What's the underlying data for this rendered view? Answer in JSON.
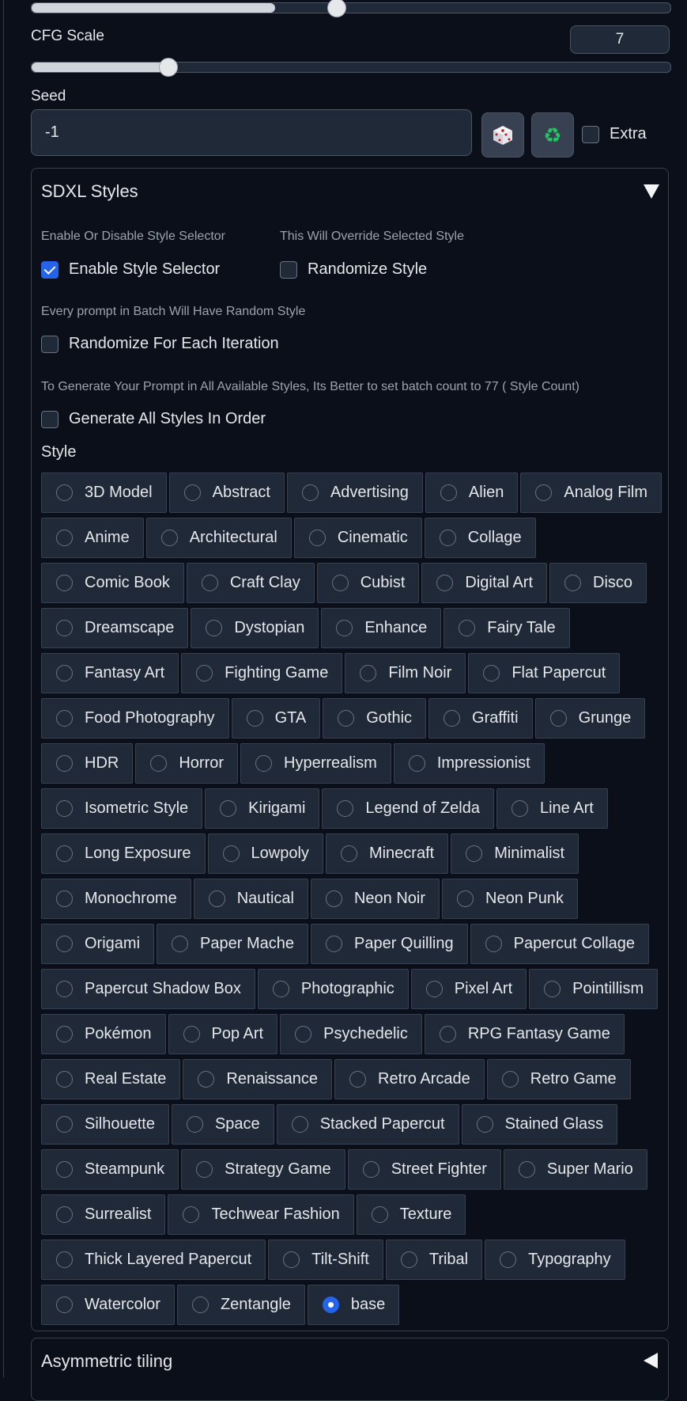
{
  "cfg": {
    "label": "CFG Scale",
    "value": "7"
  },
  "seed": {
    "label": "Seed",
    "value": "-1",
    "extra_label": "Extra"
  },
  "sdxl": {
    "title": "SDXL Styles",
    "enable_info": "Enable Or Disable Style Selector",
    "enable_label": "Enable Style Selector",
    "override_info": "This Will Override Selected Style",
    "randomize_label": "Randomize Style",
    "batch_info": "Every prompt in Batch Will Have Random Style",
    "iteration_label": "Randomize For Each Iteration",
    "all_info": "To Generate Your Prompt in All Available Styles, Its Better to set batch count to 77 ( Style Count)",
    "all_label": "Generate All Styles In Order",
    "style_label": "Style",
    "selected": "base",
    "styles": [
      "3D Model",
      "Abstract",
      "Advertising",
      "Alien",
      "Analog Film",
      "Anime",
      "Architectural",
      "Cinematic",
      "Collage",
      "Comic Book",
      "Craft Clay",
      "Cubist",
      "Digital Art",
      "Disco",
      "Dreamscape",
      "Dystopian",
      "Enhance",
      "Fairy Tale",
      "Fantasy Art",
      "Fighting Game",
      "Film Noir",
      "Flat Papercut",
      "Food Photography",
      "GTA",
      "Gothic",
      "Graffiti",
      "Grunge",
      "HDR",
      "Horror",
      "Hyperrealism",
      "Impressionist",
      "Isometric Style",
      "Kirigami",
      "Legend of Zelda",
      "Line Art",
      "Long Exposure",
      "Lowpoly",
      "Minecraft",
      "Minimalist",
      "Monochrome",
      "Nautical",
      "Neon Noir",
      "Neon Punk",
      "Origami",
      "Paper Mache",
      "Paper Quilling",
      "Papercut Collage",
      "Papercut Shadow Box",
      "Photographic",
      "Pixel Art",
      "Pointillism",
      "Pokémon",
      "Pop Art",
      "Psychedelic",
      "RPG Fantasy Game",
      "Real Estate",
      "Renaissance",
      "Retro Arcade",
      "Retro Game",
      "Silhouette",
      "Space",
      "Stacked Papercut",
      "Stained Glass",
      "Steampunk",
      "Strategy Game",
      "Street Fighter",
      "Super Mario",
      "Surrealist",
      "Techwear Fashion",
      "Texture",
      "Thick Layered Papercut",
      "Tilt-Shift",
      "Tribal",
      "Typography",
      "Watercolor",
      "Zentangle",
      "base"
    ]
  },
  "asym": {
    "title": "Asymmetric tiling"
  },
  "icons": {
    "dice": "dice-icon",
    "recycle": "recycle-icon"
  }
}
